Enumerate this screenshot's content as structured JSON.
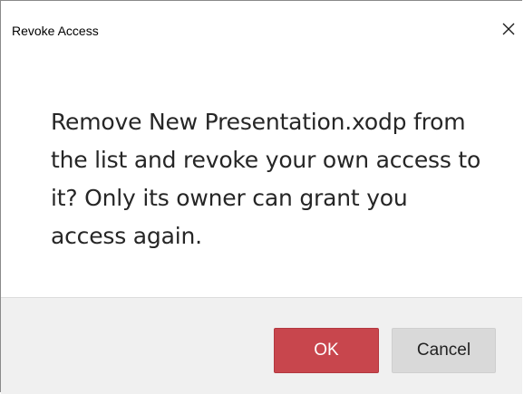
{
  "dialog": {
    "title": "Revoke Access",
    "close_icon": "close-icon",
    "message": "Remove New Presentation.xodp from the list and revoke your own access to it? Only its owner can grant you access again.",
    "buttons": {
      "ok_label": "OK",
      "cancel_label": "Cancel"
    },
    "colors": {
      "ok_background": "#c8464d",
      "cancel_background": "#d9d9d9",
      "footer_background": "#f0f0f0"
    }
  }
}
